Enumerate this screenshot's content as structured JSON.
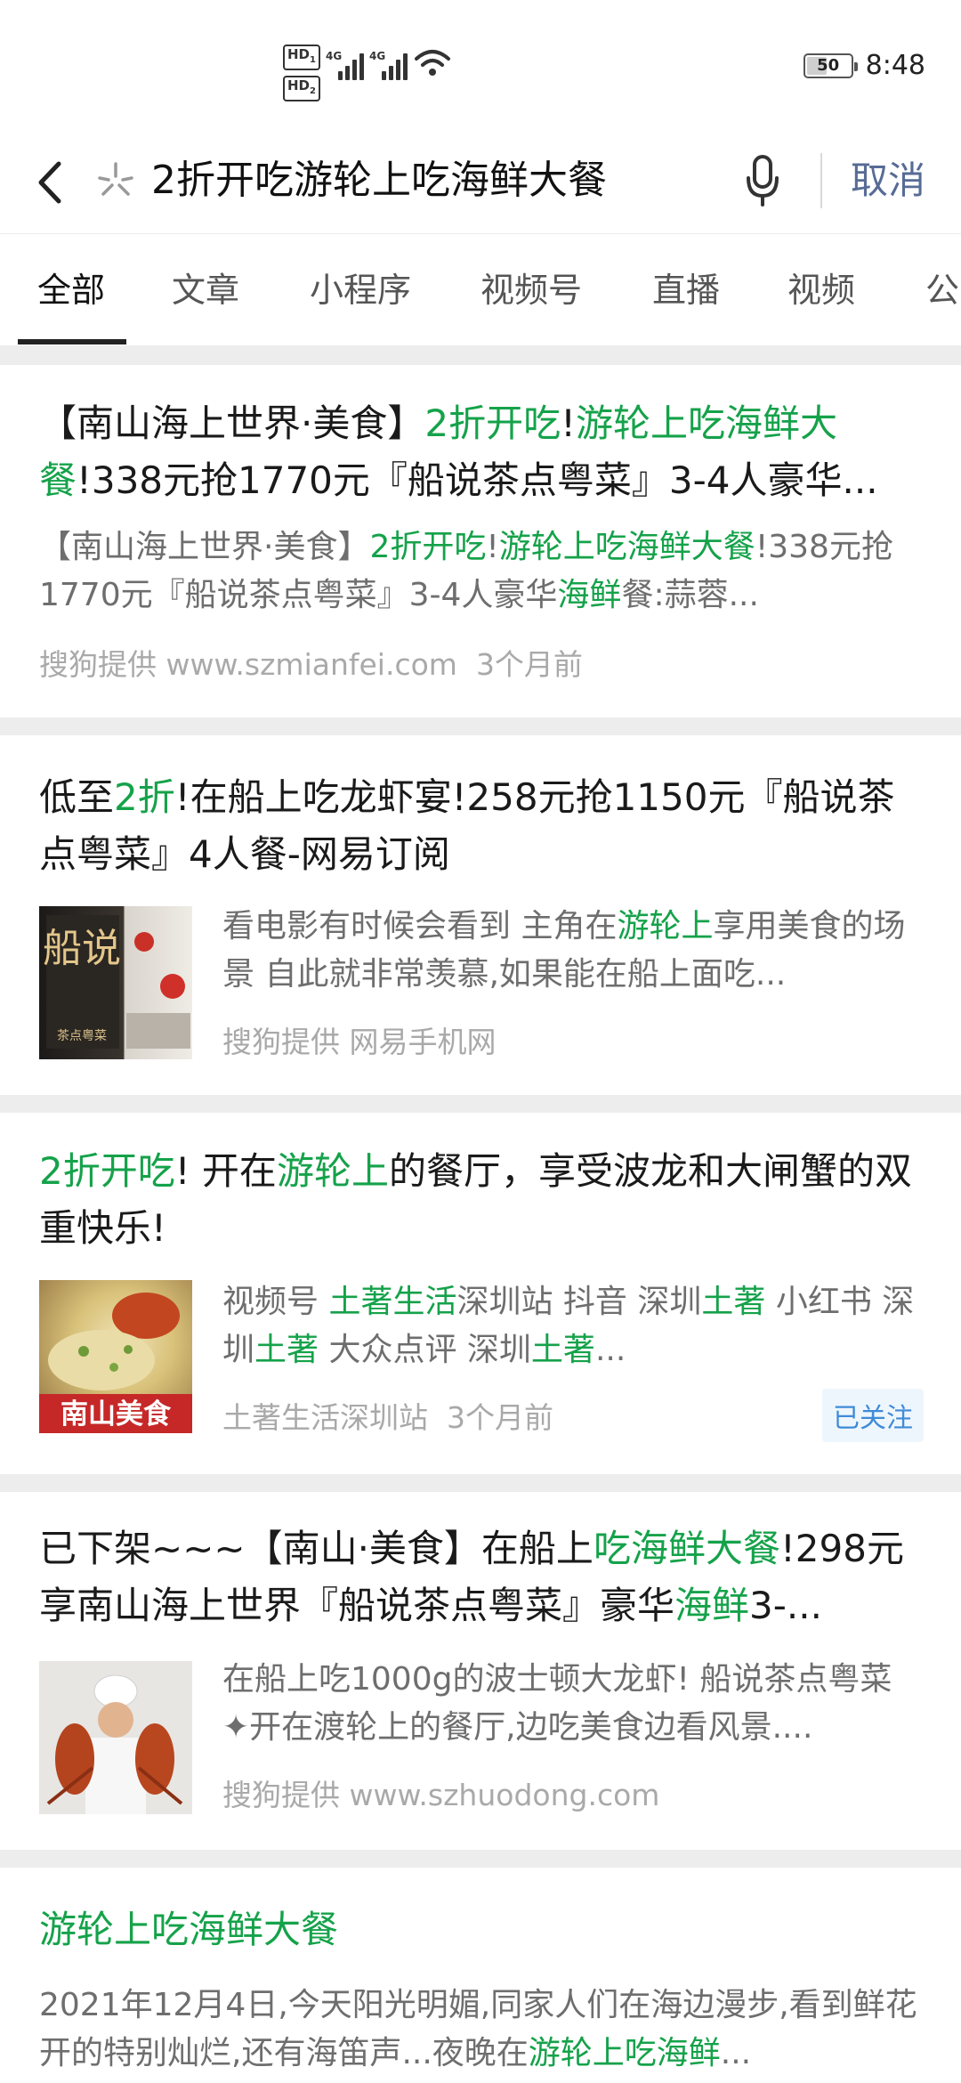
{
  "status_bar": {
    "hd1": "HD",
    "hd1_sub": "1",
    "hd2": "HD",
    "hd2_sub": "2",
    "net1": "4G",
    "net2": "4G",
    "battery": "50",
    "battery_level_pct": 50,
    "time": "8:48"
  },
  "search": {
    "query": "2折开吃游轮上吃海鲜大餐",
    "cancel_label": "取消"
  },
  "tabs": [
    "全部",
    "文章",
    "小程序",
    "视频号",
    "直播",
    "视频",
    "公"
  ],
  "active_tab_index": 0,
  "results": [
    {
      "title": [
        "【南山海上世界·美食】",
        "2折开吃",
        "!",
        "游轮上吃海鲜大餐",
        "!338元抢1770元『船说茶点粤菜』3-4人豪华..."
      ],
      "desc": [
        "【南山海上世界·美食】",
        "2折开吃",
        "!",
        "游轮上吃海鲜大餐",
        "!338元抢1770元『船说茶点粤菜』3-4人豪华",
        "海鲜",
        "餐:蒜蓉..."
      ],
      "source": "搜狗提供 www.szmianfei.com",
      "time": "3个月前"
    },
    {
      "title": [
        "低至",
        "2折",
        "!在船上吃龙虾宴!258元抢1150元『船说茶点粤菜』4人餐-网易订阅"
      ],
      "desc": [
        "看电影有时候会看到 主角在",
        "游轮上",
        "享用美食的场景 自此就非常羡慕,如果能在船上面吃..."
      ],
      "source": "搜狗提供 网易手机网",
      "thumb_text": "船说",
      "thumb_sub": "茶点粤菜"
    },
    {
      "title": [
        "2折开吃",
        "! 开在",
        "游轮上",
        "的餐厅，享受波龙和大闸蟹的双重快乐!"
      ],
      "desc": [
        "视频号 ",
        "土著生活",
        "深圳站 抖音 深圳",
        "土著",
        " 小红书 深圳",
        "土著",
        " 大众点评 深圳",
        "土著",
        "..."
      ],
      "source": "土著生活深圳站",
      "time": "3个月前",
      "badge": "已关注",
      "thumb_caption": "南山美食"
    },
    {
      "title": [
        "已下架~~~【南山·美食】在船上",
        "吃海鲜大餐",
        "!298元享南山海上世界『船说茶点粤菜』豪华",
        "海鲜",
        "3-..."
      ],
      "desc": [
        "在船上吃1000g的波士顿大龙虾! 船说茶点粤菜 ✦开在渡轮上的餐厅,边吃美食边看风景...."
      ],
      "source": "搜狗提供 www.szhuodong.com"
    },
    {
      "title": [
        "游轮上吃海鲜大餐"
      ],
      "desc": [
        "2021年12月4日,今天阳光明媚,同家人们在海边漫步,看到鲜花开的特别灿烂,还有海笛声...夜晚在",
        "游轮上吃海鲜",
        "..."
      ]
    }
  ],
  "colors": {
    "highlight": "#15a24a",
    "cancel": "#576b95",
    "badge": "#3f8bd8"
  }
}
